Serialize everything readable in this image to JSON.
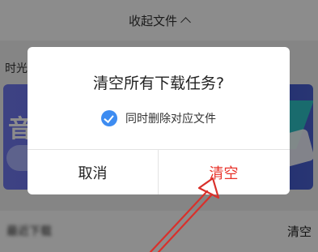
{
  "header": {
    "collapse_label": "收起文件"
  },
  "section_label": "时光",
  "banner": {
    "title_partial": "音"
  },
  "recent": {
    "label": "最近下载",
    "clear_label": "清空"
  },
  "dialog": {
    "title": "清空所有下载任务?",
    "checkbox_label": "同时删除对应文件",
    "checkbox_checked": true,
    "cancel_label": "取消",
    "confirm_label": "清空",
    "confirm_color": "#e8332b",
    "check_color": "#3d8cf1"
  },
  "annotation": {
    "arrow_color": "#d9302b"
  }
}
